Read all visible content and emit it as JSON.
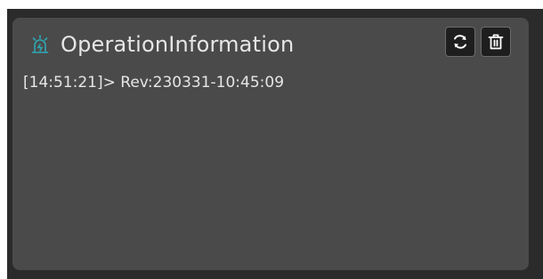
{
  "panel": {
    "title": "OperationInformation",
    "title_icon": "alarm-beacon-icon",
    "accent_color": "#2fa7b4",
    "actions": [
      {
        "name": "refresh-button",
        "icon": "refresh-icon"
      },
      {
        "name": "clear-log-button",
        "icon": "trash-icon"
      }
    ]
  },
  "log": {
    "entries": [
      {
        "time": "[14:51:21]",
        "separator": ">",
        "message": "Rev:230331-10:45:09"
      }
    ]
  },
  "colors": {
    "outer_background": "#2b2b2b",
    "panel_background": "#4a4a4a",
    "text": "#e6e6e6",
    "button_background": "#1e1e1e"
  }
}
